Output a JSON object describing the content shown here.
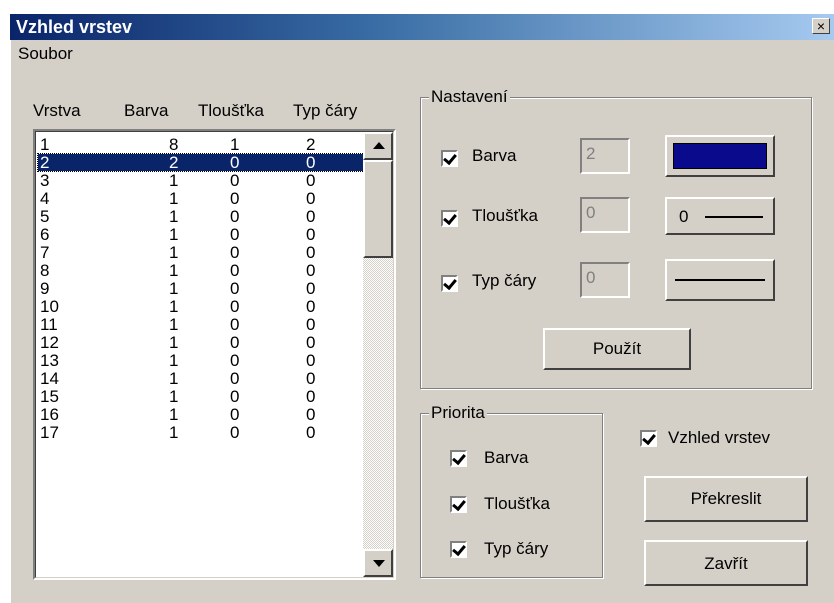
{
  "window": {
    "title": "Vzhled vrstev",
    "close_glyph": "×"
  },
  "menu": {
    "items": [
      "Soubor"
    ]
  },
  "columns": [
    "Vrstva",
    "Barva",
    "Tloušťka",
    "Typ čáry"
  ],
  "rows": [
    [
      "1",
      "8",
      "1",
      "2"
    ],
    [
      "2",
      "2",
      "0",
      "0"
    ],
    [
      "3",
      "1",
      "0",
      "0"
    ],
    [
      "4",
      "1",
      "0",
      "0"
    ],
    [
      "5",
      "1",
      "0",
      "0"
    ],
    [
      "6",
      "1",
      "0",
      "0"
    ],
    [
      "7",
      "1",
      "0",
      "0"
    ],
    [
      "8",
      "1",
      "0",
      "0"
    ],
    [
      "9",
      "1",
      "0",
      "0"
    ],
    [
      "10",
      "1",
      "0",
      "0"
    ],
    [
      "11",
      "1",
      "0",
      "0"
    ],
    [
      "12",
      "1",
      "0",
      "0"
    ],
    [
      "13",
      "1",
      "0",
      "0"
    ],
    [
      "14",
      "1",
      "0",
      "0"
    ],
    [
      "15",
      "1",
      "0",
      "0"
    ],
    [
      "16",
      "1",
      "0",
      "0"
    ],
    [
      "17",
      "1",
      "0",
      "0"
    ]
  ],
  "selected_row": 2,
  "settings": {
    "title": "Nastavení",
    "barva": {
      "label": "Barva",
      "checked": true,
      "value": "2",
      "swatch_color": "#0a0a8c"
    },
    "tloustka": {
      "label": "Tloušťka",
      "checked": true,
      "value": "0",
      "button_label": "0"
    },
    "typ": {
      "label": "Typ čáry",
      "checked": true,
      "value": "0"
    },
    "apply_label": "Použít"
  },
  "priority": {
    "title": "Priorita",
    "items": [
      {
        "label": "Barva",
        "checked": true
      },
      {
        "label": "Tloušťka",
        "checked": true
      },
      {
        "label": "Typ čáry",
        "checked": true
      }
    ]
  },
  "vzhled_checkbox": {
    "label": "Vzhled vrstev",
    "checked": true
  },
  "buttons": {
    "redraw": "Překreslit",
    "close": "Zavřít"
  }
}
